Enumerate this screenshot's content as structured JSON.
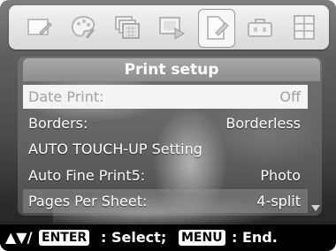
{
  "icon_bar": {
    "tabs": [
      {
        "icon": "picture-frame-icon",
        "selected": false
      },
      {
        "icon": "palette-icon",
        "selected": false
      },
      {
        "icon": "image-stack-icon",
        "selected": false
      },
      {
        "icon": "slideshow-icon",
        "selected": false
      },
      {
        "icon": "print-setup-icon",
        "selected": true
      },
      {
        "icon": "toolbox-icon",
        "selected": false
      },
      {
        "icon": "cabinet-icon",
        "selected": false
      }
    ]
  },
  "menu": {
    "title": "Print setup",
    "items": [
      {
        "label": "Date Print:",
        "value": "Off",
        "selected": true
      },
      {
        "label": "Borders:",
        "value": "Borderless",
        "selected": false
      },
      {
        "label": "AUTO TOUCH-UP Setting",
        "value": "",
        "selected": false
      },
      {
        "label": "Auto Fine Print5:",
        "value": "Photo",
        "selected": false
      },
      {
        "label": "Pages Per Sheet:",
        "value": "4-split",
        "selected": false
      }
    ]
  },
  "guide": {
    "arrows": "▲▼/",
    "enter_key": "ENTER",
    "enter_action": ": Select;",
    "menu_key": "MENU",
    "menu_action": ": End."
  },
  "colors": {
    "selected_row_bg": "#f3f3f3",
    "selected_text": "#a3a3a3",
    "title_bg": "#8d8d8d",
    "guide_bg": "#000000"
  }
}
